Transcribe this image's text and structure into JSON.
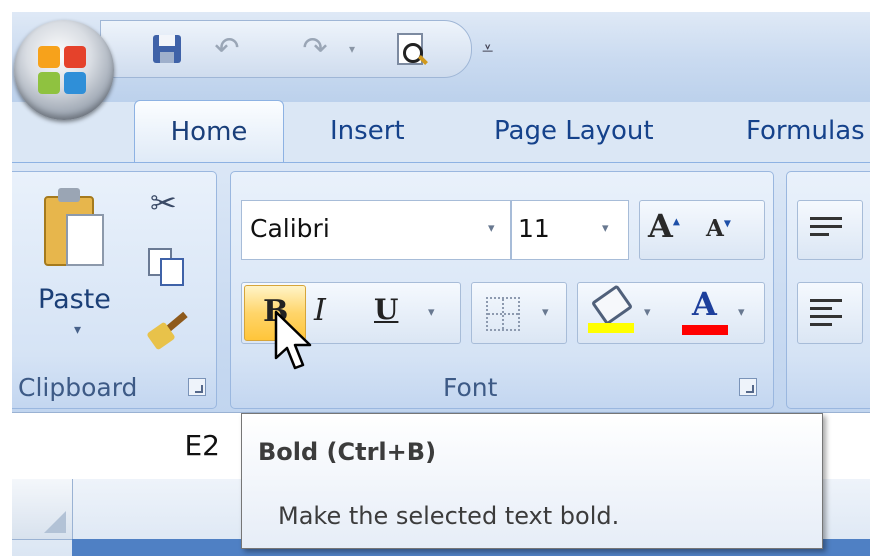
{
  "tabs": {
    "home": "Home",
    "insert": "Insert",
    "page_layout": "Page Layout",
    "formulas": "Formulas"
  },
  "quick_access_toolbar": {
    "icons": [
      "office-button-icon",
      "save-icon",
      "undo-icon",
      "redo-icon",
      "print-preview-icon",
      "customize-qat-icon"
    ]
  },
  "clipboard": {
    "paste_label": "Paste",
    "group_label": "Clipboard"
  },
  "font": {
    "font_name": "Calibri",
    "font_size": "11",
    "group_label": "Font",
    "grow_label": "A",
    "shrink_label": "A",
    "bold_label": "B",
    "italic_label": "I",
    "underline_label": "U",
    "font_color_label": "A",
    "highlight_color": "#ffff00",
    "font_color": "#ff0000",
    "bold_state": "hover"
  },
  "formula_bar": {
    "name_box": "E2"
  },
  "tooltip": {
    "title": "Bold (Ctrl+B)",
    "description": "Make the selected text bold."
  },
  "colors": {
    "ribbon_bg": "#c7d9f1",
    "tab_text": "#15428b",
    "hover_button": "#ffd56a"
  }
}
